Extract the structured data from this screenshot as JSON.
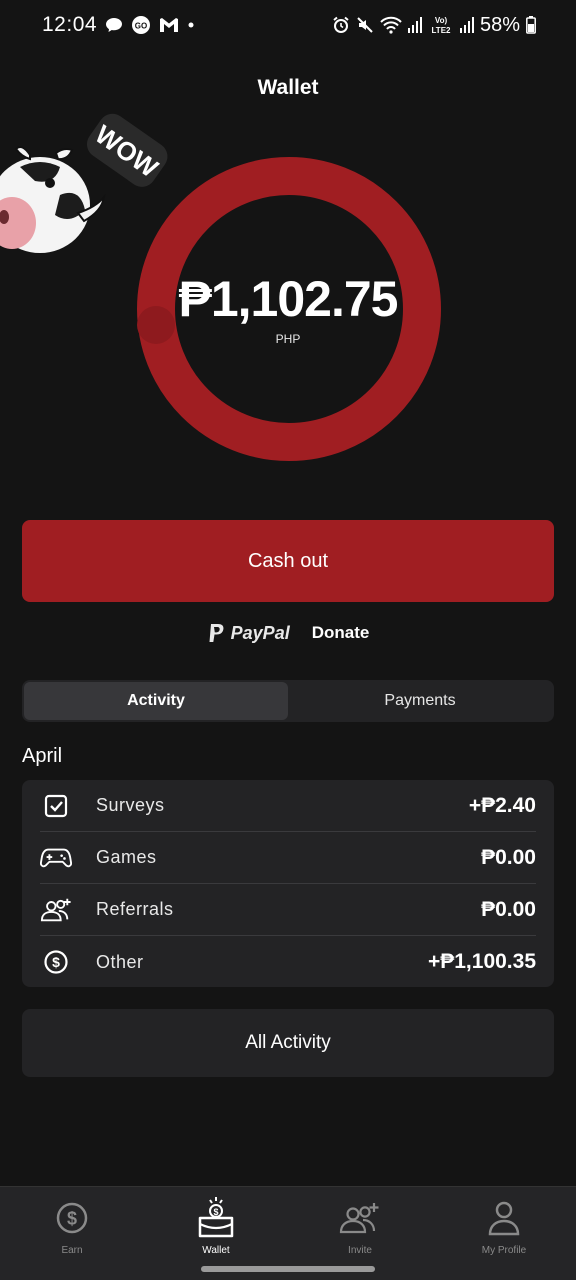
{
  "status_bar": {
    "time": "12:04",
    "battery_text": "58%",
    "left_icons": [
      "chat-bubble-icon",
      "go-icon",
      "gmail-icon",
      "dot-icon"
    ],
    "right_icons": [
      "alarm-icon",
      "mute-icon",
      "wifi-icon",
      "signal-icon",
      "volte-icon",
      "signal-icon",
      "battery-icon"
    ],
    "volte_text": "Vo) LTE2"
  },
  "header": {
    "title": "Wallet"
  },
  "balance": {
    "amount": "₱1,102.75",
    "currency": "PHP"
  },
  "mascot": {
    "text": "WOW"
  },
  "cashout": {
    "label": "Cash out"
  },
  "payment_methods": {
    "paypal": "PayPal",
    "donate": "Donate"
  },
  "tabs": [
    {
      "label": "Activity",
      "active": true
    },
    {
      "label": "Payments",
      "active": false
    }
  ],
  "activity": {
    "month": "April",
    "rows": [
      {
        "icon": "checkbox-icon",
        "label": "Surveys",
        "amount": "+₱2.40"
      },
      {
        "icon": "gamepad-icon",
        "label": "Games",
        "amount": "₱0.00"
      },
      {
        "icon": "add-users-icon",
        "label": "Referrals",
        "amount": "₱0.00"
      },
      {
        "icon": "dollar-circle-icon",
        "label": "Other",
        "amount": "+₱1,100.35"
      }
    ]
  },
  "all_activity": {
    "label": "All Activity"
  },
  "bottom_nav": [
    {
      "icon": "dollar-circle-icon",
      "label": "Earn",
      "active": false
    },
    {
      "icon": "wallet-icon",
      "label": "Wallet",
      "active": true
    },
    {
      "icon": "add-users-icon",
      "label": "Invite",
      "active": false
    },
    {
      "icon": "person-icon",
      "label": "My Profile",
      "active": false
    }
  ],
  "colors": {
    "accent": "#a01e22",
    "background": "#141414",
    "card": "#232325"
  }
}
